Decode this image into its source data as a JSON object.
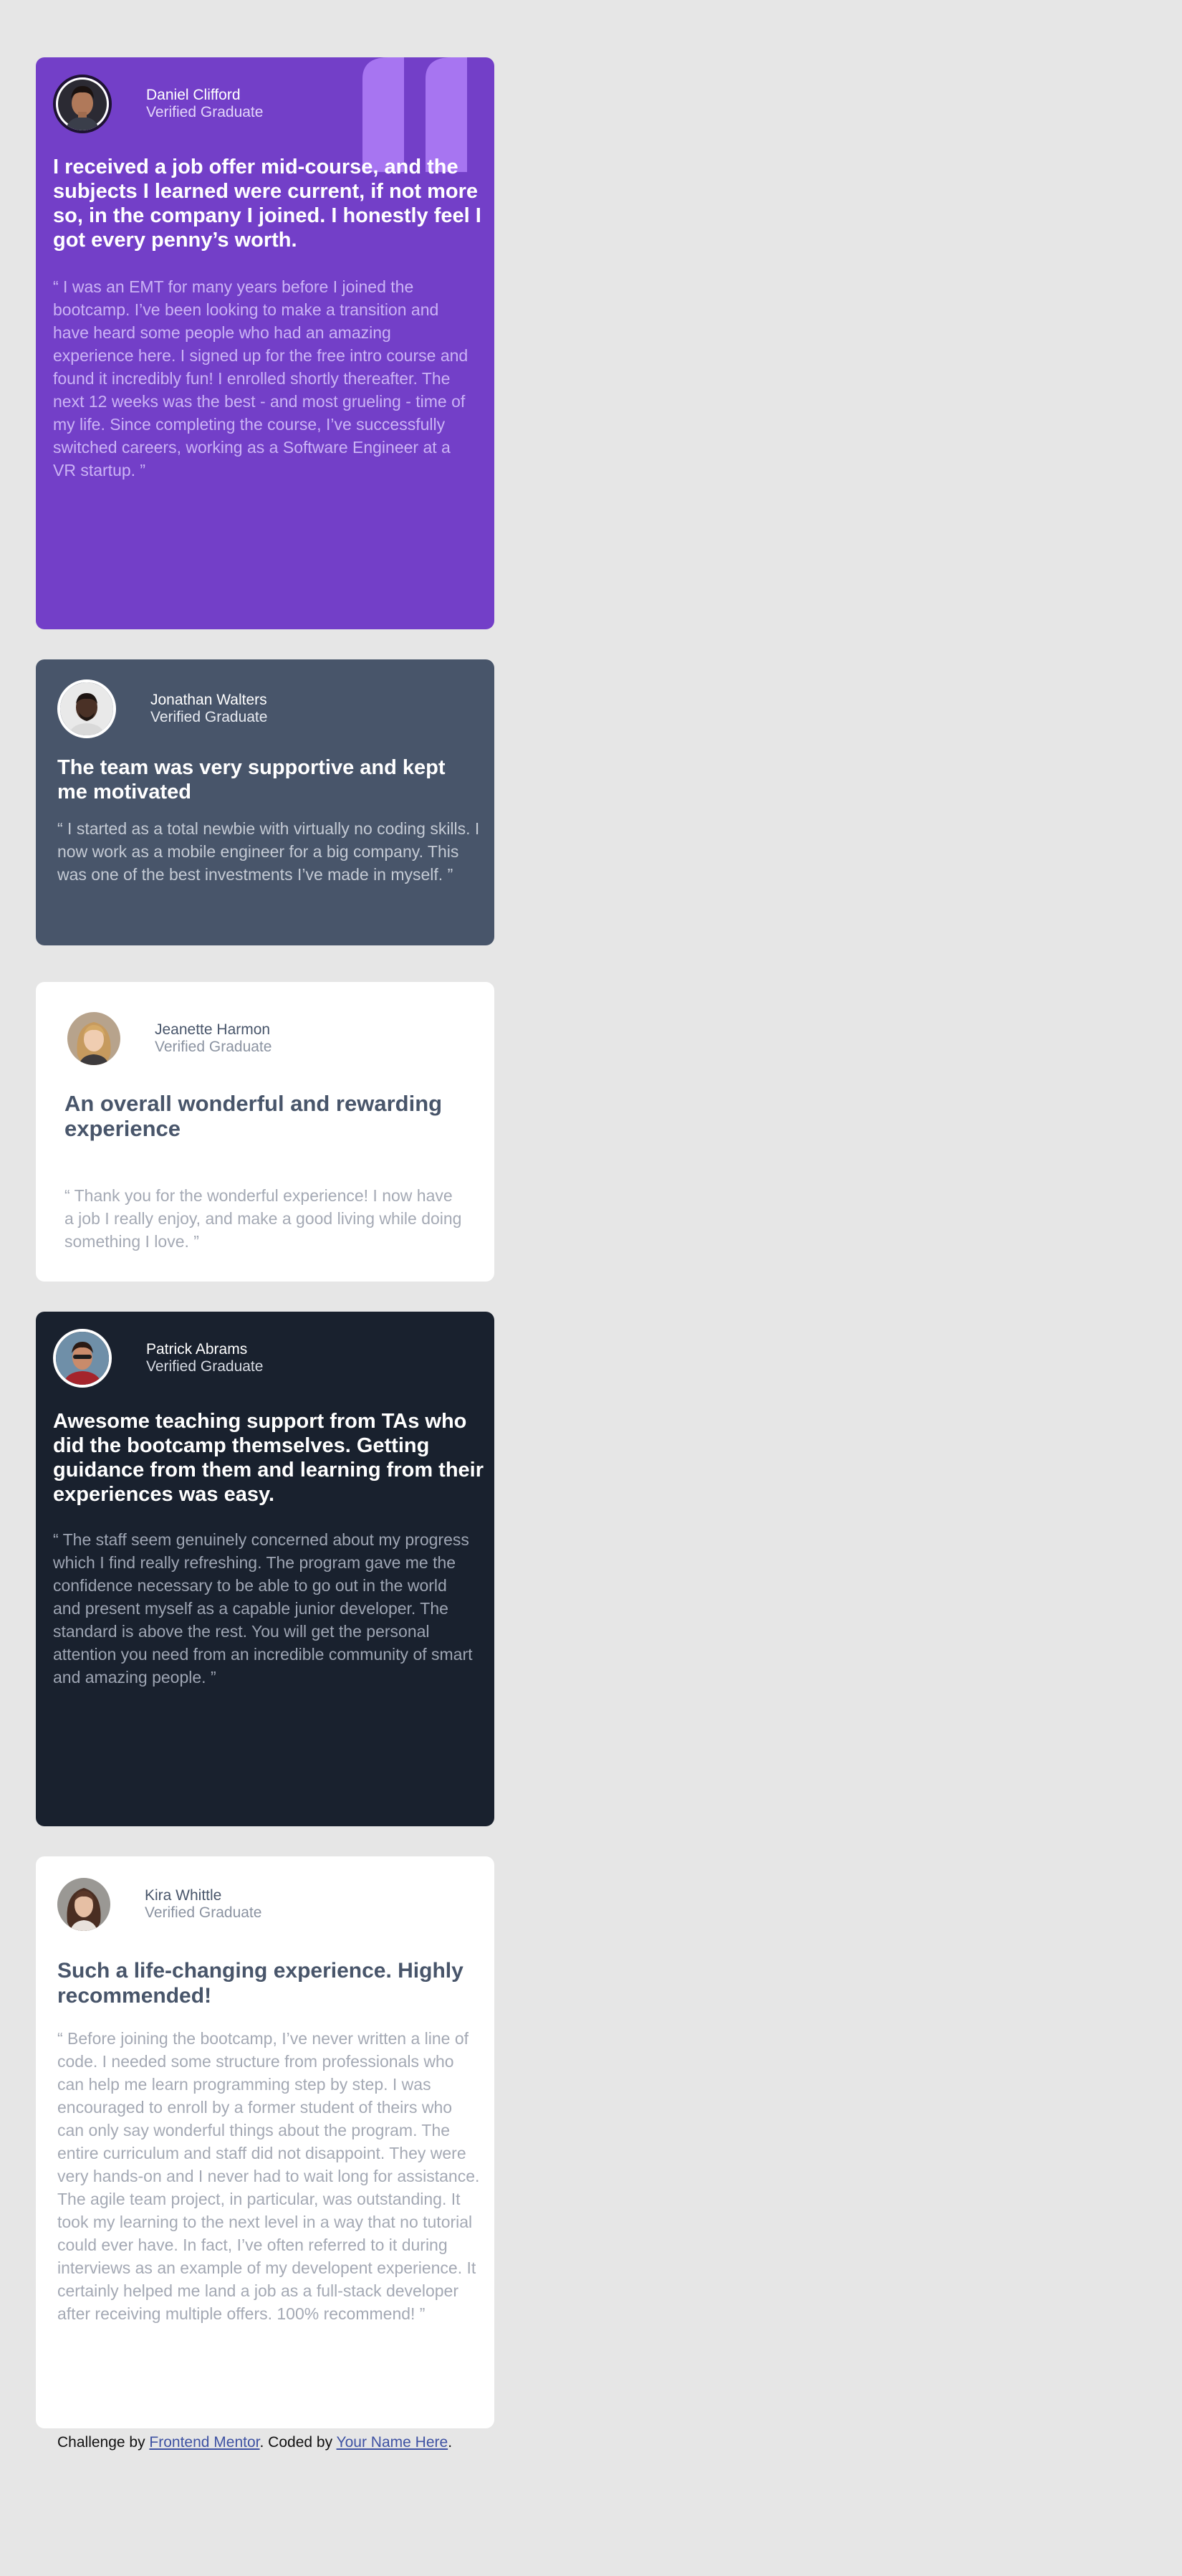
{
  "testimonials": {
    "daniel": {
      "name": "Daniel Clifford",
      "role": "Verified Graduate",
      "headline": "I received a job offer mid-course, and the subjects I learned were current, if not more so, in the company I joined. I honestly feel I got every penny’s worth.",
      "body": "“ I was an EMT for many years before I joined the bootcamp. I’ve been looking to make a transition and have heard some people who had an amazing experience here. I signed up for the free intro course and found it incredibly fun! I enrolled shortly thereafter. The next 12 weeks was the best - and most grueling - time of my life. Since completing the course, I’ve successfully switched careers, working as a Software Engineer at a VR startup. ”"
    },
    "jonathan": {
      "name": "Jonathan Walters",
      "role": "Verified Graduate",
      "headline": "The team was very supportive and kept me motivated",
      "body": "“ I started as a total newbie with virtually no coding skills. I now work as a mobile engineer for a big company. This was one of the best investments I’ve made in myself. ”"
    },
    "jeanette": {
      "name": "Jeanette Harmon",
      "role": "Verified Graduate",
      "headline": "An overall wonderful and rewarding experience",
      "body": "“ Thank you for the wonderful experience! I now have a job I really enjoy, and make a good living while doing something I love. ”"
    },
    "patrick": {
      "name": "Patrick Abrams",
      "role": "Verified Graduate",
      "headline": "Awesome teaching support from TAs who did the bootcamp themselves. Getting guidance from them and learning from their experiences was easy.",
      "body": "“ The staff seem genuinely concerned about my progress which I find really refreshing. The program gave me the confidence necessary to be able to go out in the world and present myself as a capable junior developer. The standard is above the rest. You will get the personal attention you need from an incredible community of smart and amazing people. ”"
    },
    "kira": {
      "name": "Kira Whittle",
      "role": "Verified Graduate",
      "headline": "Such a life-changing experience. Highly recommended!",
      "body": "“ Before joining the bootcamp, I’ve never written a line of code. I needed some structure from professionals who can help me learn programming step by step. I was encouraged to enroll by a former student of theirs who can only say wonderful things about the program. The entire curriculum and staff did not disappoint. They were very hands-on and I never had to wait long for assistance. The agile team project, in particular, was outstanding. It took my learning to the next level in a way that no tutorial could ever have. In fact, I’ve often referred to it during interviews as an example of my developent experience. It certainly helped me land a job as a full-stack developer after receiving multiple offers. 100% recommend! ”"
    }
  },
  "attribution": {
    "prefix": "Challenge by ",
    "frontend_mentor_link": "Frontend Mentor",
    "middle": ". Coded by ",
    "author_link": "Your Name Here",
    "suffix": "."
  },
  "colors": {
    "page_bg": "#e6e6e6",
    "purple": "#733fc8",
    "slate": "#48556a",
    "white": "#ffffff",
    "dark": "#19212e",
    "quote_mark": "#a775f1"
  },
  "icons": {
    "quote": "quotation-mark-icon"
  }
}
